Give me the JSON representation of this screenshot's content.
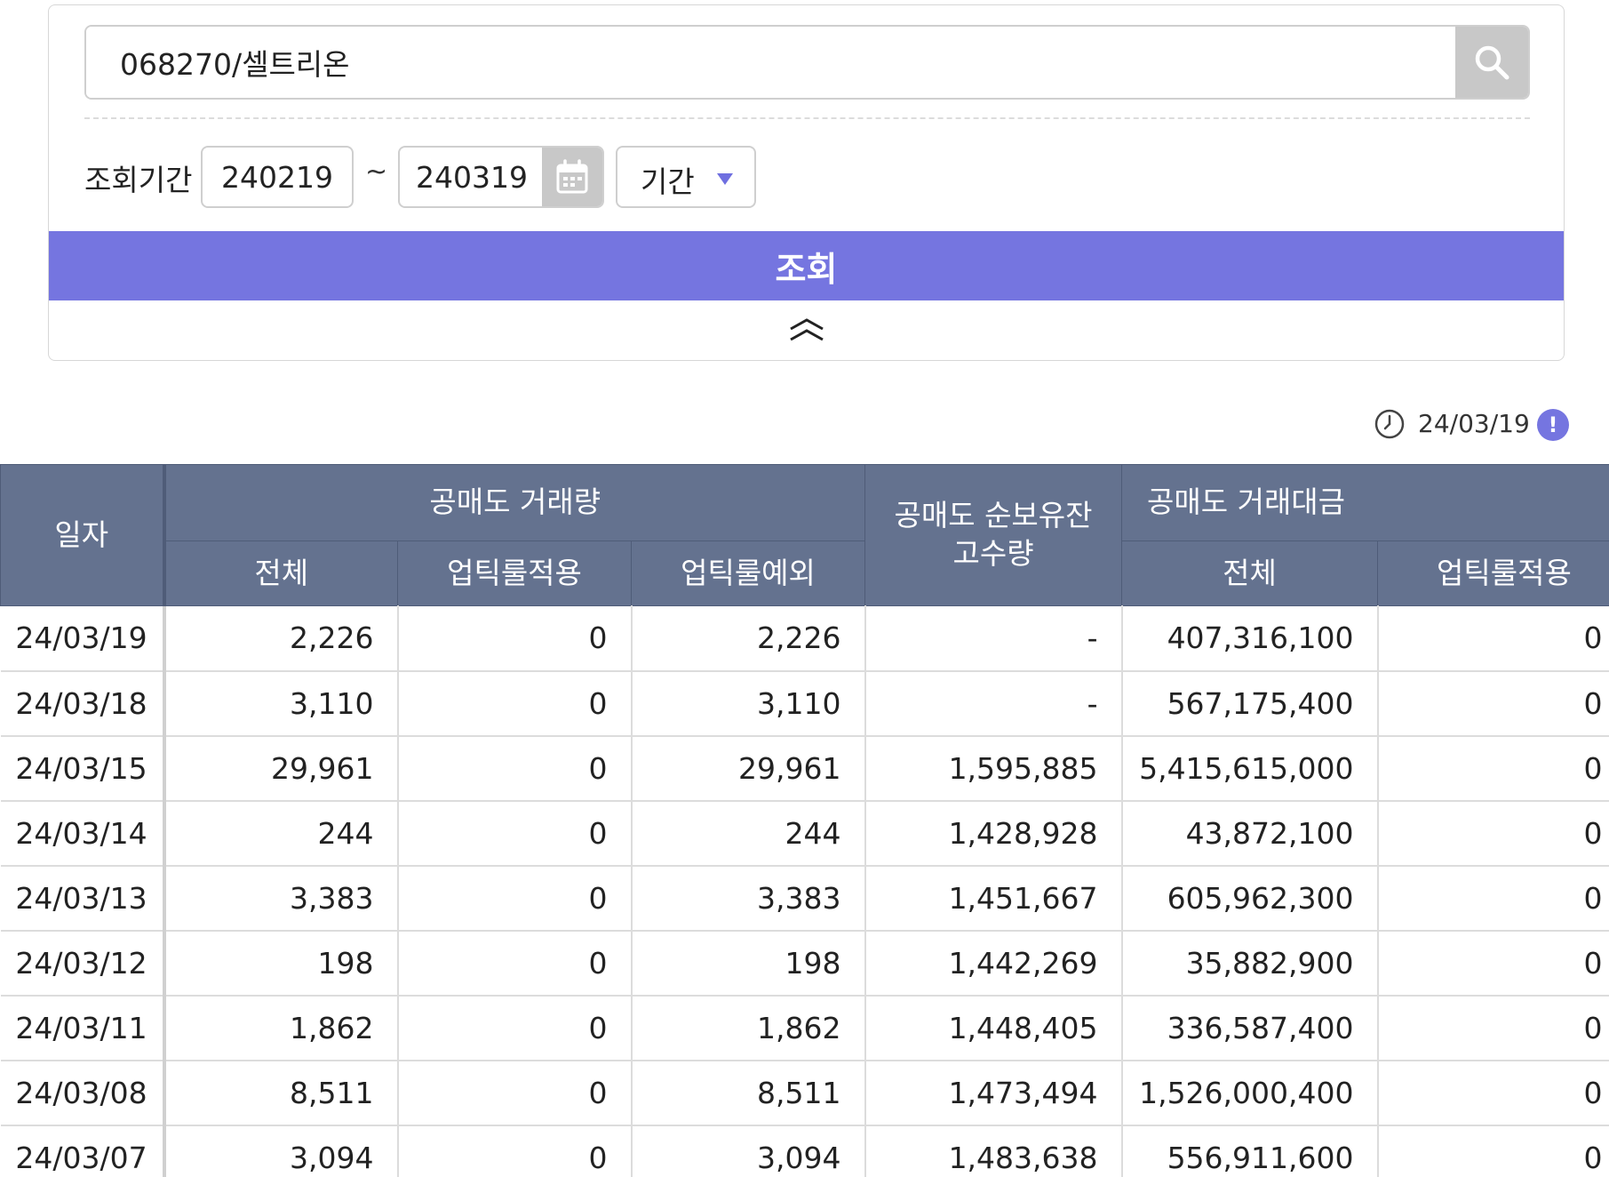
{
  "search": {
    "value": "068270/셀트리온",
    "button_icon": "search-icon"
  },
  "period": {
    "label": "조회기간",
    "from": "240219",
    "separator": "~",
    "to": "240319",
    "calendar_icon": "calendar-icon",
    "select_label": "기간"
  },
  "query_button": {
    "label": "조회"
  },
  "collapse_icon": "chevron-double-up-icon",
  "timestamp": {
    "value": "24/03/19",
    "info_icon": "info-icon",
    "info_symbol": "!"
  },
  "colors": {
    "accent": "#7575e0",
    "header_bg": "#64728f",
    "button_gray": "#c8c8c8"
  },
  "table": {
    "headers": {
      "date": "일자",
      "short_volume_group": "공매도 거래량",
      "net_position_line1": "공매도 순보유잔",
      "net_position_line2": "고수량",
      "short_amount_group": "공매도 거래대금",
      "sub_total": "전체",
      "sub_uptick_applied": "업틱룰적용",
      "sub_uptick_exempt": "업틱룰예외",
      "sub_total_2": "전체",
      "sub_uptick_applied_2": "업틱룰적용"
    },
    "rows": [
      {
        "date": "24/03/19",
        "vol_total": "2,226",
        "vol_applied": "0",
        "vol_exempt": "2,226",
        "net_position": "-",
        "amt_total": "407,316,100",
        "amt_applied": "0"
      },
      {
        "date": "24/03/18",
        "vol_total": "3,110",
        "vol_applied": "0",
        "vol_exempt": "3,110",
        "net_position": "-",
        "amt_total": "567,175,400",
        "amt_applied": "0"
      },
      {
        "date": "24/03/15",
        "vol_total": "29,961",
        "vol_applied": "0",
        "vol_exempt": "29,961",
        "net_position": "1,595,885",
        "amt_total": "5,415,615,000",
        "amt_applied": "0"
      },
      {
        "date": "24/03/14",
        "vol_total": "244",
        "vol_applied": "0",
        "vol_exempt": "244",
        "net_position": "1,428,928",
        "amt_total": "43,872,100",
        "amt_applied": "0"
      },
      {
        "date": "24/03/13",
        "vol_total": "3,383",
        "vol_applied": "0",
        "vol_exempt": "3,383",
        "net_position": "1,451,667",
        "amt_total": "605,962,300",
        "amt_applied": "0"
      },
      {
        "date": "24/03/12",
        "vol_total": "198",
        "vol_applied": "0",
        "vol_exempt": "198",
        "net_position": "1,442,269",
        "amt_total": "35,882,900",
        "amt_applied": "0"
      },
      {
        "date": "24/03/11",
        "vol_total": "1,862",
        "vol_applied": "0",
        "vol_exempt": "1,862",
        "net_position": "1,448,405",
        "amt_total": "336,587,400",
        "amt_applied": "0"
      },
      {
        "date": "24/03/08",
        "vol_total": "8,511",
        "vol_applied": "0",
        "vol_exempt": "8,511",
        "net_position": "1,473,494",
        "amt_total": "1,526,000,400",
        "amt_applied": "0"
      },
      {
        "date": "24/03/07",
        "vol_total": "3,094",
        "vol_applied": "0",
        "vol_exempt": "3,094",
        "net_position": "1,483,638",
        "amt_total": "556,911,600",
        "amt_applied": "0"
      }
    ]
  }
}
